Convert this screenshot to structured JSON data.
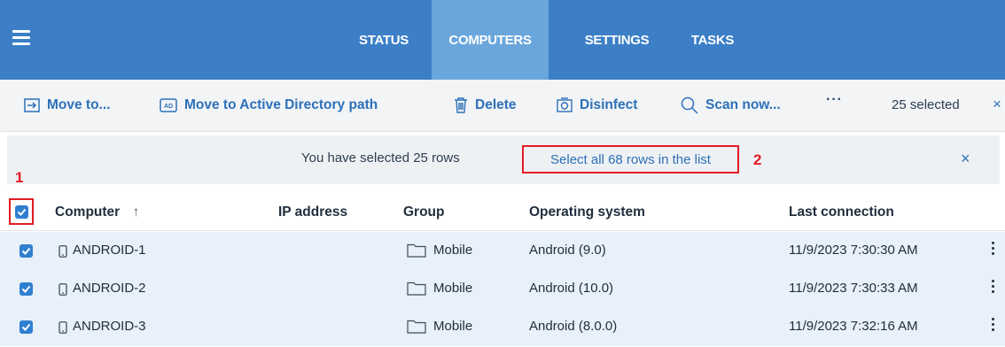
{
  "nav": {
    "tabs": [
      {
        "label": "STATUS",
        "active": false
      },
      {
        "label": "COMPUTERS",
        "active": true
      },
      {
        "label": "SETTINGS",
        "active": false
      },
      {
        "label": "TASKS",
        "active": false
      }
    ]
  },
  "toolbar": {
    "move_to": "Move to...",
    "move_ad": "Move to Active Directory path",
    "delete": "Delete",
    "disinfect": "Disinfect",
    "scan_now": "Scan now...",
    "more": "···",
    "selected_count": "25 selected",
    "close": "×"
  },
  "banner": {
    "text": "You have selected 25 rows",
    "select_all": "Select all 68 rows in the list",
    "close": "×"
  },
  "callouts": {
    "one": "1",
    "two": "2"
  },
  "table": {
    "headers": {
      "computer": "Computer",
      "sort_arrow": "↑",
      "ip": "IP address",
      "group": "Group",
      "os": "Operating system",
      "last": "Last connection"
    },
    "rows": [
      {
        "computer": "ANDROID-1",
        "ip": "",
        "group": "Mobile",
        "os": "Android (9.0)",
        "last": "11/9/2023 7:30:30 AM",
        "checked": true
      },
      {
        "computer": "ANDROID-2",
        "ip": "",
        "group": "Mobile",
        "os": "Android (10.0)",
        "last": "11/9/2023 7:30:33 AM",
        "checked": true
      },
      {
        "computer": "ANDROID-3",
        "ip": "",
        "group": "Mobile",
        "os": "Android (8.0.0)",
        "last": "11/9/2023 7:32:16 AM",
        "checked": true
      }
    ]
  },
  "colors": {
    "nav_bg": "#3c7fc7",
    "nav_active": "#6aa6dc",
    "link": "#2d70b9",
    "highlight": "#e31b23",
    "row_selected": "#e8f0f9",
    "checkbox": "#2f7fd0"
  }
}
